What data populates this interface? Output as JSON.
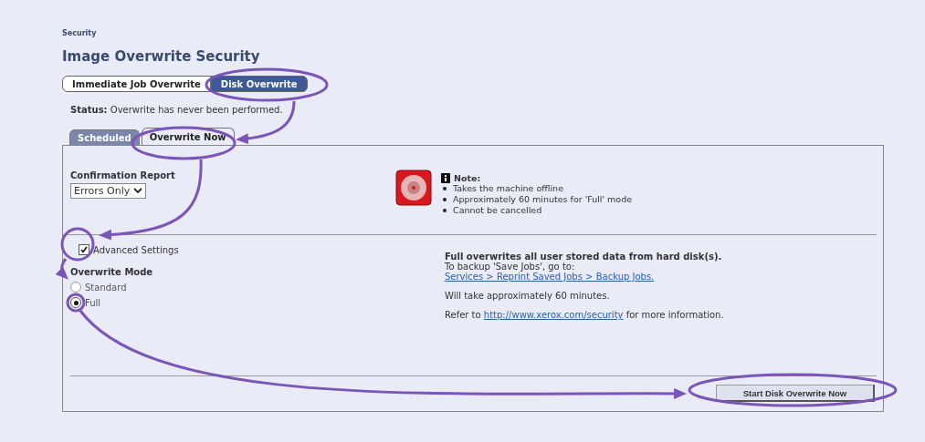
{
  "breadcrumb": "Security",
  "title": "Image Overwrite Security",
  "mode_buttons": [
    {
      "label": "Immediate Job Overwrite",
      "selected": false
    },
    {
      "label": "Disk Overwrite",
      "selected": true
    }
  ],
  "status": {
    "label": "Status:",
    "text": "Overwrite has never been performed."
  },
  "tabs": [
    {
      "label": "Scheduled",
      "selected": false
    },
    {
      "label": "Overwrite Now",
      "selected": true
    }
  ],
  "confirmation_report": {
    "label": "Confirmation Report",
    "value": "Errors Only"
  },
  "note": {
    "title": "Note:",
    "items": [
      "Takes the machine offline",
      "Approximately 60 minutes for 'Full' mode",
      "Cannot be cancelled"
    ]
  },
  "advanced_settings": {
    "label": "Advanced Settings",
    "checked": true
  },
  "overwrite_mode": {
    "label": "Overwrite Mode",
    "options": [
      {
        "label": "Standard",
        "selected": false
      },
      {
        "label": "Full",
        "selected": true
      }
    ]
  },
  "info": {
    "heading": "Full overwrites all user stored data from hard disk(s).",
    "backup_text": "To backup 'Save Jobs', go to:",
    "backup_link": "Services > Reprint Saved Jobs > Backup Jobs.",
    "duration": "Will take approximately 60 minutes.",
    "refer_before": "Refer to",
    "refer_link": "http://www.xerox.com/security",
    "refer_after": "for more information."
  },
  "start_button": "Start Disk Overwrite Now"
}
